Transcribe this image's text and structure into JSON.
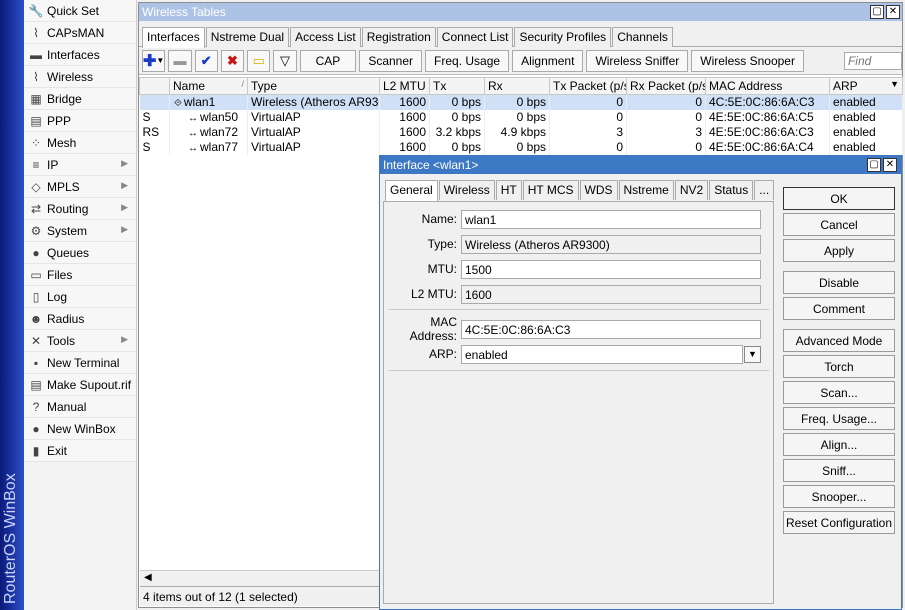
{
  "app": {
    "brand": "RouterOS WinBox"
  },
  "menu": [
    {
      "label": "Quick Set",
      "icon": "quickset-icon",
      "glyph": "🔧",
      "sub": false
    },
    {
      "label": "CAPsMAN",
      "icon": "capsman-icon",
      "glyph": "⌇",
      "sub": false
    },
    {
      "label": "Interfaces",
      "icon": "interfaces-icon",
      "glyph": "▬",
      "sub": false
    },
    {
      "label": "Wireless",
      "icon": "wireless-icon",
      "glyph": "⌇",
      "sub": false
    },
    {
      "label": "Bridge",
      "icon": "bridge-icon",
      "glyph": "▦",
      "sub": false
    },
    {
      "label": "PPP",
      "icon": "ppp-icon",
      "glyph": "▤",
      "sub": false
    },
    {
      "label": "Mesh",
      "icon": "mesh-icon",
      "glyph": "⁘",
      "sub": false
    },
    {
      "label": "IP",
      "icon": "ip-icon",
      "glyph": "≡",
      "sub": true
    },
    {
      "label": "MPLS",
      "icon": "mpls-icon",
      "glyph": "◇",
      "sub": true
    },
    {
      "label": "Routing",
      "icon": "routing-icon",
      "glyph": "⇄",
      "sub": true
    },
    {
      "label": "System",
      "icon": "system-icon",
      "glyph": "⚙",
      "sub": true
    },
    {
      "label": "Queues",
      "icon": "queues-icon",
      "glyph": "●",
      "sub": false
    },
    {
      "label": "Files",
      "icon": "files-icon",
      "glyph": "▭",
      "sub": false
    },
    {
      "label": "Log",
      "icon": "log-icon",
      "glyph": "▯",
      "sub": false
    },
    {
      "label": "Radius",
      "icon": "radius-icon",
      "glyph": "☻",
      "sub": false
    },
    {
      "label": "Tools",
      "icon": "tools-icon",
      "glyph": "✕",
      "sub": true
    },
    {
      "label": "New Terminal",
      "icon": "terminal-icon",
      "glyph": "▪",
      "sub": false
    },
    {
      "label": "Make Supout.rif",
      "icon": "supout-icon",
      "glyph": "▤",
      "sub": false
    },
    {
      "label": "Manual",
      "icon": "manual-icon",
      "glyph": "?",
      "sub": false
    },
    {
      "label": "New WinBox",
      "icon": "winbox-icon",
      "glyph": "●",
      "sub": false
    },
    {
      "label": "Exit",
      "icon": "exit-icon",
      "glyph": "▮",
      "sub": false
    }
  ],
  "tables": {
    "title": "Wireless Tables",
    "tabs": [
      "Interfaces",
      "Nstreme Dual",
      "Access List",
      "Registration",
      "Connect List",
      "Security Profiles",
      "Channels"
    ],
    "toolbar": {
      "cap": "CAP",
      "scanner": "Scanner",
      "freq": "Freq. Usage",
      "alignment": "Alignment",
      "sniffer": "Wireless Sniffer",
      "snooper": "Wireless Snooper",
      "find_placeholder": "Find"
    },
    "columns": [
      "",
      "Name",
      "Type",
      "L2 MTU",
      "Tx",
      "Rx",
      "Tx Packet (p/s)",
      "Rx Packet (p/s)",
      "MAC Address",
      "ARP"
    ],
    "sort_glyph": "/",
    "rows": [
      {
        "flag": "",
        "name": "wlan1",
        "type": "Wireless (Atheros AR9300)",
        "l2mtu": "1600",
        "tx": "0 bps",
        "rx": "0 bps",
        "txp": "0",
        "rxp": "0",
        "mac": "4C:5E:0C:86:6A:C3",
        "arp": "enabled",
        "sel": true,
        "indent": false
      },
      {
        "flag": "S",
        "name": "wlan50",
        "type": "VirtualAP",
        "l2mtu": "1600",
        "tx": "0 bps",
        "rx": "0 bps",
        "txp": "0",
        "rxp": "0",
        "mac": "4E:5E:0C:86:6A:C5",
        "arp": "enabled",
        "sel": false,
        "indent": true
      },
      {
        "flag": "RS",
        "name": "wlan72",
        "type": "VirtualAP",
        "l2mtu": "1600",
        "tx": "3.2 kbps",
        "rx": "4.9 kbps",
        "txp": "3",
        "rxp": "3",
        "mac": "4E:5E:0C:86:6A:C3",
        "arp": "enabled",
        "sel": false,
        "indent": true
      },
      {
        "flag": "S",
        "name": "wlan77",
        "type": "VirtualAP",
        "l2mtu": "1600",
        "tx": "0 bps",
        "rx": "0 bps",
        "txp": "0",
        "rxp": "0",
        "mac": "4E:5E:0C:86:6A:C4",
        "arp": "enabled",
        "sel": false,
        "indent": true
      }
    ],
    "status": "4 items out of 12 (1 selected)"
  },
  "dialog": {
    "title": "Interface <wlan1>",
    "tabs": [
      "General",
      "Wireless",
      "HT",
      "HT MCS",
      "WDS",
      "Nstreme",
      "NV2",
      "Status",
      "..."
    ],
    "fields": [
      {
        "label": "Name:",
        "value": "wlan1",
        "ro": false
      },
      {
        "label": "Type:",
        "value": "Wireless (Atheros AR9300)",
        "ro": true
      },
      {
        "label": "MTU:",
        "value": "1500",
        "ro": false
      },
      {
        "label": "L2 MTU:",
        "value": "1600",
        "ro": true
      },
      {
        "label": "MAC Address:",
        "value": "4C:5E:0C:86:6A:C3",
        "ro": false
      },
      {
        "label": "ARP:",
        "value": "enabled",
        "ro": false
      }
    ],
    "buttons": [
      "OK",
      "Cancel",
      "Apply",
      "Disable",
      "Comment",
      "Advanced Mode",
      "Torch",
      "Scan...",
      "Freq. Usage...",
      "Align...",
      "Sniff...",
      "Snooper...",
      "Reset Configuration"
    ]
  }
}
